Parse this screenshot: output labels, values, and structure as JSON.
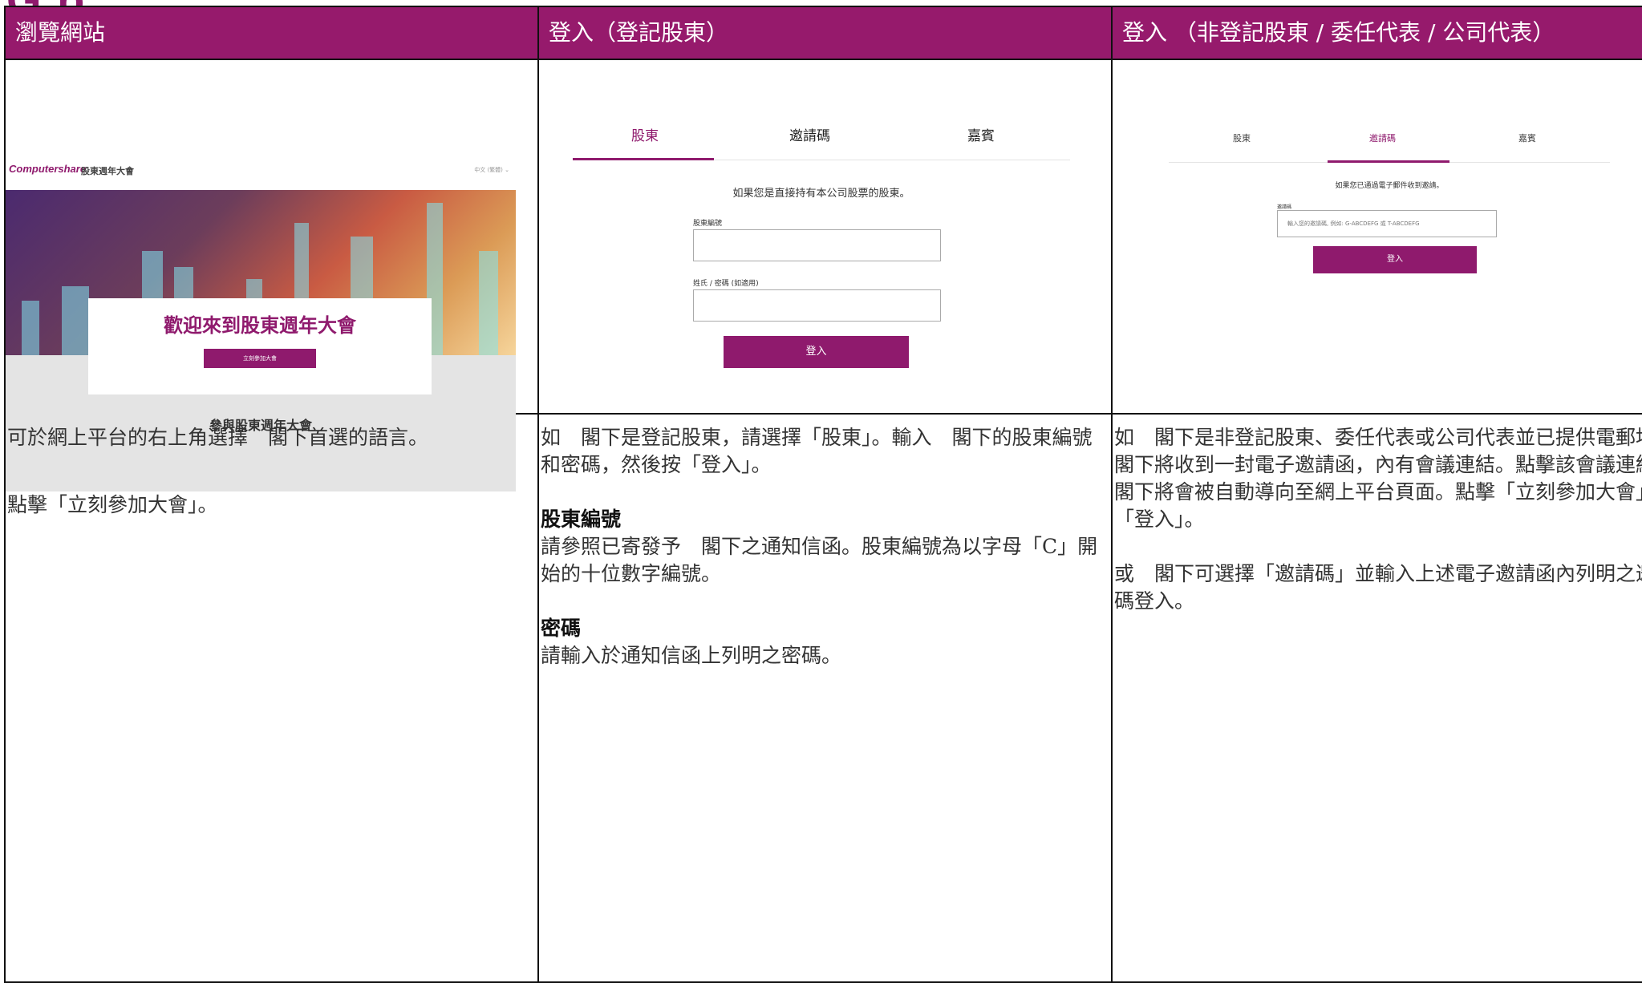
{
  "brand": {
    "partial_logo": "G p"
  },
  "columns": [
    {
      "header": "瀏覽網站",
      "screenshot": {
        "logo": "Computershare",
        "site_title": "股東週年大會",
        "language": "中文 (繁體)",
        "welcome_title": "歡迎來到股東週年大會",
        "join_button": "立刻參加大會",
        "section_title": "參與股東週年大會"
      },
      "paragraphs": [
        "可於網上平台的右上角選擇　閣下首選的語言。",
        "點擊「立刻參加大會」。"
      ]
    },
    {
      "header": "登入（登記股東）",
      "screenshot": {
        "tabs": [
          "股東",
          "邀請碼",
          "嘉賓"
        ],
        "active_tab": "股東",
        "prompt": "如果您是直接持有本公司股票的股東。",
        "field1_label": "股東編號",
        "field2_label": "姓氏 / 密碼 (如適用)",
        "login_button": "登入"
      },
      "paragraphs": [
        "如　閣下是登記股東，請選擇「股東」。輸入　閣下的股東編號和密碼，然後按「登入」。",
        "股東編號",
        "請參照已寄發予　閣下之通知信函。股東編號為以字母「C」開始的十位數字編號。",
        "密碼",
        "請輸入於通知信函上列明之密碼。"
      ]
    },
    {
      "header": "登入 （非登記股東 / 委任代表 / 公司代表）",
      "screenshot": {
        "tabs": [
          "股東",
          "邀請碼",
          "嘉賓"
        ],
        "active_tab": "邀請碼",
        "prompt": "如果您已通過電子郵件收到邀請。",
        "field_label": "邀請碼",
        "placeholder": "輸入您的邀請碼, 例如: G-ABCDEFG 或 T-ABCDEFG",
        "login_button": "登入"
      },
      "paragraphs": [
        "如　閣下是非登記股東、委任代表或公司代表並已提供電郵地址，　閣下將收到一封電子邀請函，內有會議連結。點擊該會議連結後，　閣下將會被自動導向至網上平台頁面。點擊「立刻參加大會」及「登入」。",
        "或　閣下可選擇「邀請碼」並輸入上述電子邀請函內列明之邀請碼登入。"
      ]
    }
  ],
  "colors": {
    "header_bg": "#961a6c",
    "accent": "#8f1a6d"
  }
}
